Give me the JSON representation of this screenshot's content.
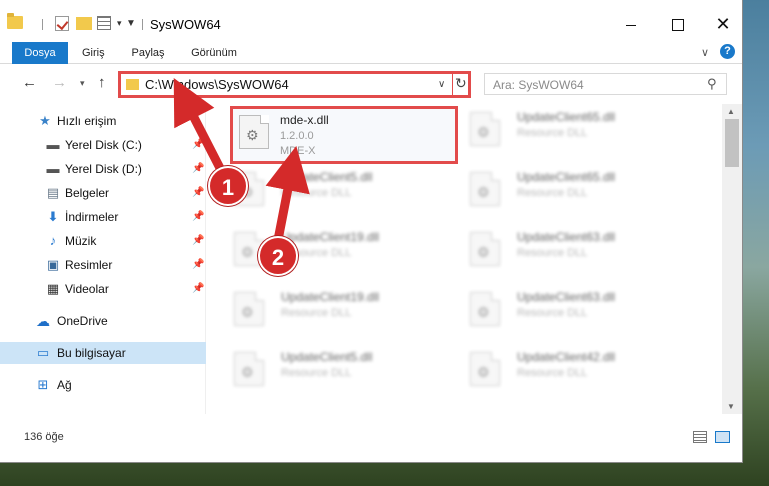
{
  "window": {
    "title": "SysWOW64",
    "controls": {
      "minimize": "",
      "maximize": "",
      "close": "✕"
    }
  },
  "ribbon": {
    "tabs": [
      "Dosya",
      "Giriş",
      "Paylaş",
      "Görünüm"
    ],
    "help": "?"
  },
  "nav": {
    "address": "C:\\Windows\\SysWOW64",
    "search_placeholder": "Ara: SysWOW64"
  },
  "sidebar": {
    "items": [
      {
        "label": "Hızlı erişim",
        "icon": "star-icon",
        "pinned": false
      },
      {
        "label": "Yerel Disk (C:)",
        "icon": "drive-icon",
        "pinned": true
      },
      {
        "label": "Yerel Disk (D:)",
        "icon": "drive-icon",
        "pinned": true
      },
      {
        "label": "Belgeler",
        "icon": "document-icon",
        "pinned": true
      },
      {
        "label": "İndirmeler",
        "icon": "download-icon",
        "pinned": true
      },
      {
        "label": "Müzik",
        "icon": "music-icon",
        "pinned": true
      },
      {
        "label": "Resimler",
        "icon": "pictures-icon",
        "pinned": true
      },
      {
        "label": "Videolar",
        "icon": "video-icon",
        "pinned": true
      },
      {
        "label": "OneDrive",
        "icon": "cloud-icon",
        "pinned": false
      },
      {
        "label": "Bu bilgisayar",
        "icon": "computer-icon",
        "pinned": false,
        "selected": true
      },
      {
        "label": "Ağ",
        "icon": "network-icon",
        "pinned": false
      }
    ]
  },
  "files": {
    "highlighted": {
      "name": "mde-x.dll",
      "version": "1.2.0.0",
      "description": "MDE-X"
    },
    "items": [
      {
        "name": "UpdateClient65.dll",
        "type": "Resource DLL"
      },
      {
        "name": "UpdateClient5.dll",
        "type": "Resource DLL"
      },
      {
        "name": "UpdateClient65.dll",
        "type": "Resource DLL"
      },
      {
        "name": "UpdateClient19.dll",
        "type": "Resource DLL"
      },
      {
        "name": "UpdateClient63.dll",
        "type": "Resource DLL"
      },
      {
        "name": "UpdateClient19.dll",
        "type": "Resource DLL"
      },
      {
        "name": "UpdateClient63.dll",
        "type": "Resource DLL"
      },
      {
        "name": "UpdateClient5.dll",
        "type": "Resource DLL"
      },
      {
        "name": "UpdateClient42.dll",
        "type": "Resource DLL"
      }
    ]
  },
  "status": {
    "count": "136 öğe"
  },
  "annotations": {
    "step1": "1",
    "step2": "2"
  },
  "colors": {
    "accent": "#1979ca",
    "annotation": "#e24b4b",
    "selection": "#cce4f7"
  }
}
